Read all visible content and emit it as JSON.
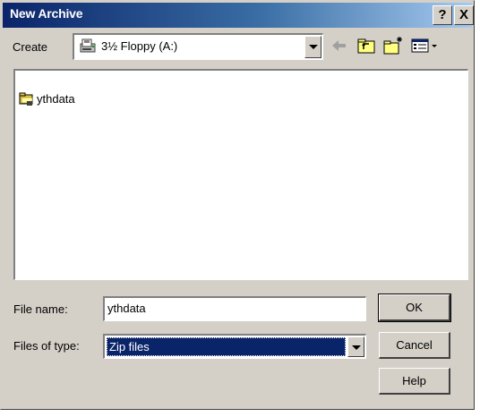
{
  "window": {
    "title": "New Archive",
    "help_button_label": "?",
    "close_button_label": "X"
  },
  "create": {
    "label": "Create",
    "location": "3½ Floppy (A:)"
  },
  "toolbar": {
    "icons": [
      "back-icon",
      "up-one-level-icon",
      "new-folder-icon",
      "view-menu-icon"
    ]
  },
  "files": [
    {
      "name": "ythdata",
      "icon": "folder-icon"
    }
  ],
  "filename": {
    "label": "File name:",
    "value": "ythdata"
  },
  "filetype": {
    "label": "Files of type:",
    "value": "Zip files"
  },
  "buttons": {
    "ok": "OK",
    "cancel": "Cancel",
    "help": "Help"
  },
  "colors": {
    "face": "#d4d0c8",
    "title_start": "#0a246a",
    "title_end": "#a6caf0",
    "selection": "#0a246a"
  }
}
